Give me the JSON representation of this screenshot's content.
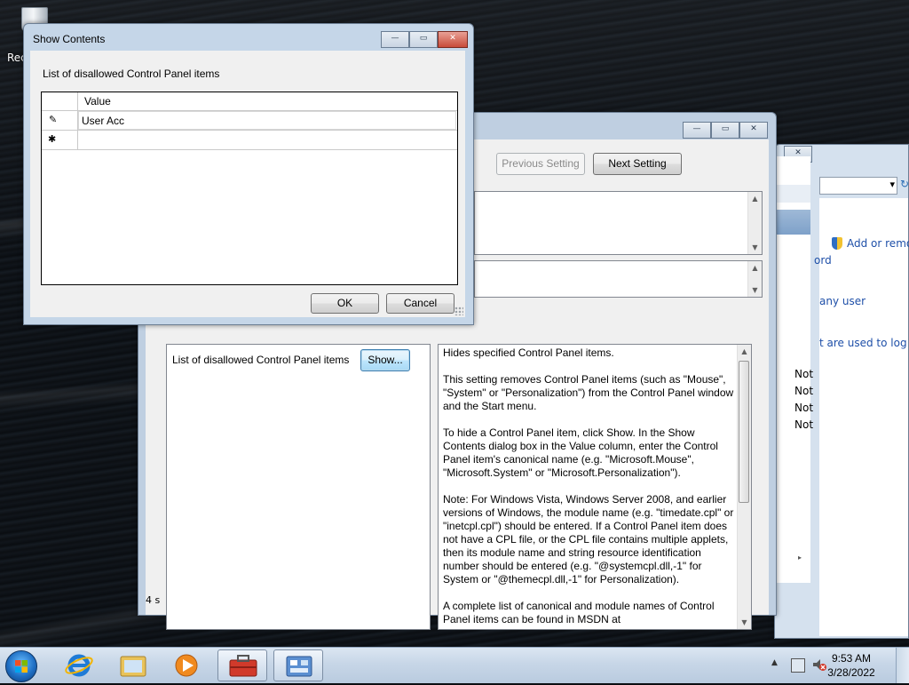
{
  "desktop": {
    "recycle_label": "Rec"
  },
  "back_window": {
    "dropdown_arrow": "▾",
    "links": [
      "Add or remov",
      "ord",
      "any user",
      "t are used to log on"
    ],
    "status_cells": [
      "Not",
      "Not",
      "Not",
      "Not"
    ],
    "close": "✕"
  },
  "policy_window": {
    "caption_buttons": [
      "—",
      "▭",
      "✕"
    ],
    "prev_button": "Previous Setting",
    "next_button": "Next Setting",
    "option_label": "List of disallowed Control Panel items",
    "show_button": "Show...",
    "left_status": "4 s",
    "help_paragraphs": [
      "Hides specified Control Panel items.",
      "This setting removes Control Panel items (such as \"Mouse\", \"System\" or \"Personalization\") from the Control Panel window and the Start menu.",
      "To hide a Control Panel item, click Show. In the Show Contents dialog box in the Value column, enter the Control Panel item's canonical name (e.g. \"Microsoft.Mouse\", \"Microsoft.System\" or \"Microsoft.Personalization\").",
      "Note: For Windows Vista, Windows Server 2008, and earlier versions of Windows, the module name (e.g. \"timedate.cpl\" or \"inetcpl.cpl\") should be entered. If a Control Panel item does not have a CPL file, or the CPL file contains multiple applets, then its module name and string resource identification number should be entered (e.g. \"@systemcpl.dll,-1\" for System or \"@themecpl.dll,-1\" for Personalization).",
      "A complete list of canonical and module names of Control Panel items can be found in MSDN at"
    ]
  },
  "show_contents": {
    "title": "Show Contents",
    "caption_buttons": [
      "—",
      "▭",
      "✕"
    ],
    "label": "List of disallowed Control Panel items",
    "column_header": "Value",
    "rows": [
      {
        "marker": "✎",
        "value": "User Acc"
      },
      {
        "marker": "✱",
        "value": ""
      }
    ],
    "ok": "OK",
    "cancel": "Cancel"
  },
  "taskbar": {
    "time": "9:53 AM",
    "date": "3/28/2022",
    "icons": [
      "start-orb",
      "internet-explorer-icon",
      "windows-explorer-icon",
      "media-player-icon",
      "toolbox-icon",
      "control-panel-icon"
    ]
  }
}
